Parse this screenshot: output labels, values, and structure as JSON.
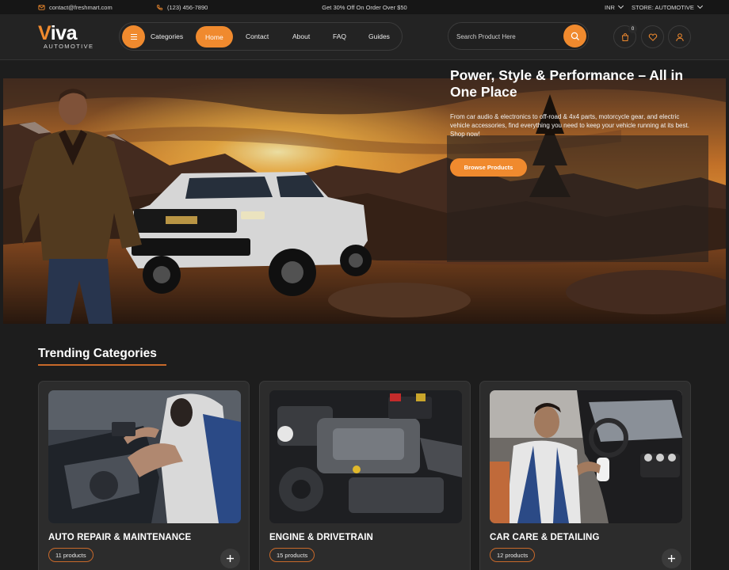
{
  "topbar": {
    "email": "contact@freshmart.com",
    "phone": "(123) 456-7890",
    "promo": "Get 30% Off On Order Over $50",
    "currency": "INR",
    "store": "STORE: AUTOMOTIVE"
  },
  "brand": {
    "accent": "#f08a2e",
    "name_first": "V",
    "name_rest": "iva",
    "tagline": "AUTOMOTIVE"
  },
  "nav": {
    "items": [
      {
        "label": "Categories"
      },
      {
        "label": "Home",
        "active": true
      },
      {
        "label": "Contact"
      },
      {
        "label": "About"
      },
      {
        "label": "FAQ"
      },
      {
        "label": "Guides"
      }
    ]
  },
  "search": {
    "placeholder": "Search Product Here"
  },
  "header_icons": {
    "cart_count": "0",
    "icons": [
      "cart-icon",
      "heart-icon",
      "user-icon"
    ]
  },
  "hero": {
    "title": "Power, Style & Performance – All in One Place",
    "description": "From car audio & electronics to off-road & 4x4 parts, motorcycle gear, and electric vehicle accessories, find everything you need to keep your vehicle running at its best. Shop now!",
    "button_label": "Browse Products"
  },
  "trending": {
    "title": "Trending Categories",
    "cards": [
      {
        "name": "AUTO REPAIR & MAINTENANCE",
        "count": "11 products"
      },
      {
        "name": "ENGINE & DRIVETRAIN",
        "count": "15 products"
      },
      {
        "name": "CAR CARE & DETAILING",
        "count": "12 products"
      }
    ]
  }
}
